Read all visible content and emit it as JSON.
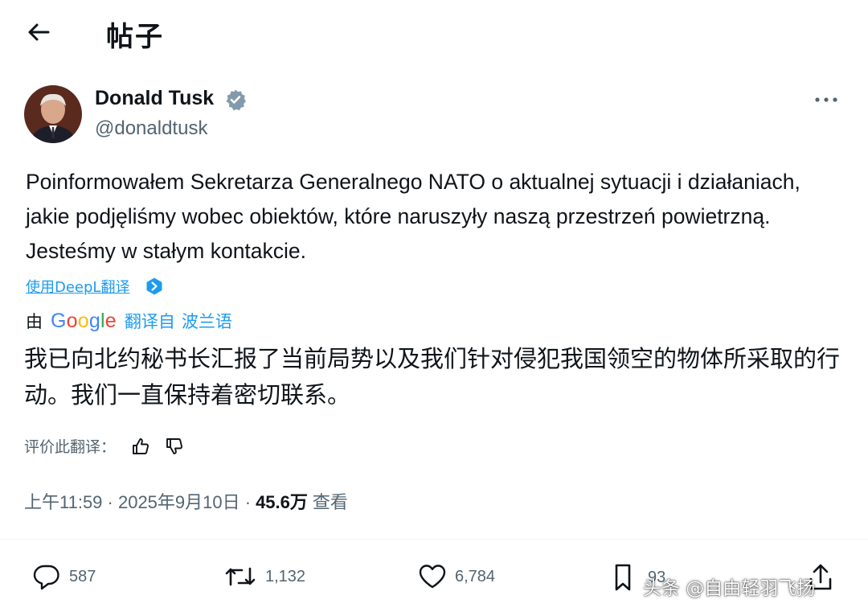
{
  "header": {
    "title": "帖子"
  },
  "author": {
    "name": "Donald Tusk",
    "handle": "@donaldtusk"
  },
  "tweet": {
    "text": "Poinformowałem Sekretarza Generalnego NATO o aktualnej sytuacji i działaniach, jakie podjęliśmy wobec obiektów, które naruszyły naszą przestrzeń powietrzną. Jesteśmy w stałym kontakcie.",
    "deepl_link": "使用DeepL翻译"
  },
  "translation": {
    "by": "由",
    "provider": "Google",
    "from": "翻译自",
    "language": "波兰语",
    "text": "我已向北约秘书长汇报了当前局势以及我们针对侵犯我国领空的物体所采取的行动。我们一直保持着密切联系。",
    "rate_label": "评价此翻译："
  },
  "meta": {
    "time_date": "上午11:59 · 2025年9月10日 ·",
    "views": "45.6万",
    "views_label": "查看"
  },
  "actions": {
    "replies": "587",
    "reposts": "1,132",
    "likes": "6,784",
    "bookmarks": "93"
  },
  "watermark": "头条 @自由轻羽飞扬",
  "colors": {
    "accent": "#1d9bf0",
    "secondary_text": "#536471",
    "primary_text": "#0f1419"
  },
  "icons": [
    "back-arrow-icon",
    "verified-badge-icon",
    "more-icon",
    "deepl-icon",
    "thumbs-up-icon",
    "thumbs-down-icon",
    "reply-icon",
    "repost-icon",
    "like-icon",
    "bookmark-icon",
    "share-icon"
  ]
}
